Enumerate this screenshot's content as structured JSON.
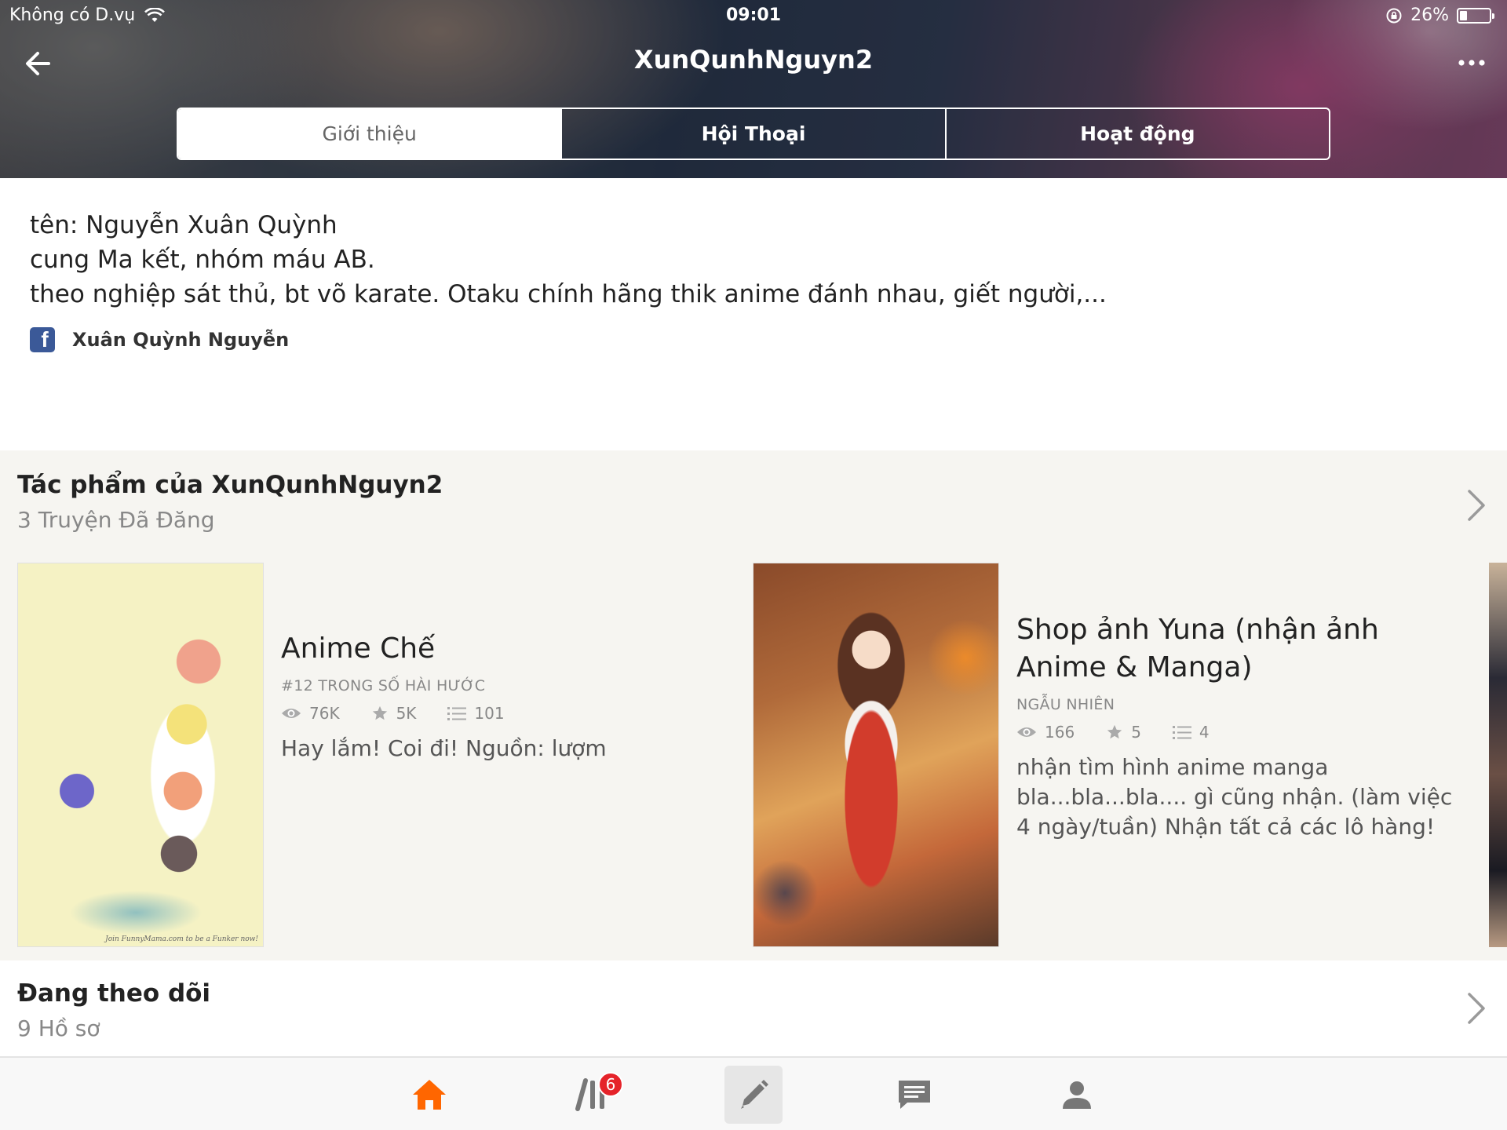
{
  "status_bar": {
    "carrier": "Không có D.vụ",
    "time": "09:01",
    "battery": "26%",
    "battery_level": 0.26
  },
  "header": {
    "title": "XunQunhNguyn2",
    "tabs": [
      {
        "label": "Giới thiệu",
        "active": true
      },
      {
        "label": "Hội Thoại",
        "active": false
      },
      {
        "label": "Hoạt động",
        "active": false
      }
    ]
  },
  "bio": {
    "lines": [
      "tên: Nguyễn Xuân Quỳnh",
      "cung Ma kết, nhóm máu AB.",
      "theo nghiệp sát thủ, bt võ karate. Otaku chính hãng thik anime đánh nhau, giết người,..."
    ],
    "facebook_name": "Xuân Quỳnh Nguyễn"
  },
  "works": {
    "title": "Tác phẩm của XunQunhNguyn2",
    "subtitle": "3 Truyện Đã Đăng",
    "stories": [
      {
        "title": "Anime Chế",
        "category": "#12 TRONG SỐ HÀI HƯỚC",
        "views": "76K",
        "votes": "5K",
        "parts": "101",
        "description": "Hay lắm! Coi đi!  Nguồn: lượm",
        "cover_caption": "Join FunnyMama.com to be a Funker now!"
      },
      {
        "title": "Shop ảnh Yuna (nhận ảnh Anime & Manga)",
        "category": "NGẪU NHIÊN",
        "views": "166",
        "votes": "5",
        "parts": "4",
        "description": "nhận tìm hình anime manga bla...bla...bla.... gì cũng nhận.  (làm việc 4 ngày/tuần) Nhận tất cả các lô hàng!"
      }
    ]
  },
  "following": {
    "title": "Đang theo dõi",
    "subtitle": "9 Hồ sơ"
  },
  "bottom_nav": {
    "library_badge": "6",
    "accent": "#ff6600"
  }
}
